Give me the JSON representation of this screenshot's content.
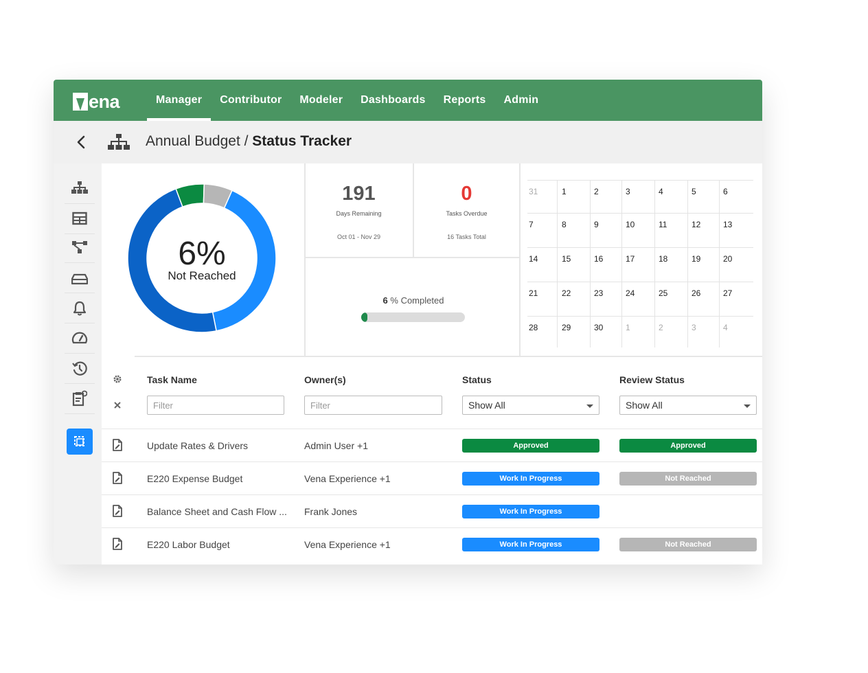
{
  "brand": {
    "logo_text": "ena",
    "nav_active_color": "#ffffff",
    "nav_bg": "#4a9562"
  },
  "nav": {
    "items": [
      {
        "label": "Manager",
        "active": true
      },
      {
        "label": "Contributor",
        "active": false
      },
      {
        "label": "Modeler",
        "active": false
      },
      {
        "label": "Dashboards",
        "active": false
      },
      {
        "label": "Reports",
        "active": false
      },
      {
        "label": "Admin",
        "active": false
      }
    ]
  },
  "breadcrumb": {
    "parent": "Annual Budget /",
    "current": "Status Tracker"
  },
  "sidebar": {
    "icons": [
      "hierarchy-icon",
      "table-grid-icon",
      "workflow-icon",
      "storage-icon",
      "bell-icon",
      "speedometer-icon",
      "history-icon",
      "clipboard-icon"
    ],
    "active_icon": "task-tracker-icon"
  },
  "donut": {
    "percent_label": "6%",
    "status_label": "Not Reached",
    "segments": [
      {
        "name": "Work In Progress (light)",
        "fraction": 0.39,
        "color": "#1a8cff"
      },
      {
        "name": "Work In Progress (dark)",
        "fraction": 0.46,
        "color": "#0b63c7"
      },
      {
        "name": "Approved",
        "fraction": 0.06,
        "color": "#0b8a41"
      },
      {
        "name": "Not Reached",
        "fraction": 0.06,
        "color": "#b6b6b6"
      }
    ]
  },
  "stats": {
    "days_remaining": {
      "value": "191",
      "label": "Days Remaining",
      "sub": "Oct 01 - Nov 29",
      "color": "#555555"
    },
    "tasks_overdue": {
      "value": "0",
      "label": "Tasks Overdue",
      "sub": "16 Tasks Total",
      "color": "#e53935"
    }
  },
  "progress": {
    "value": "6",
    "suffix": " % Completed",
    "fraction": 0.06
  },
  "calendar": {
    "weeks": [
      [
        {
          "d": "31",
          "dim": true
        },
        {
          "d": "1"
        },
        {
          "d": "2"
        },
        {
          "d": "3"
        },
        {
          "d": "4"
        },
        {
          "d": "5"
        },
        {
          "d": "6"
        }
      ],
      [
        {
          "d": "7"
        },
        {
          "d": "8"
        },
        {
          "d": "9"
        },
        {
          "d": "10"
        },
        {
          "d": "11"
        },
        {
          "d": "12"
        },
        {
          "d": "13"
        }
      ],
      [
        {
          "d": "14"
        },
        {
          "d": "15"
        },
        {
          "d": "16"
        },
        {
          "d": "17"
        },
        {
          "d": "18"
        },
        {
          "d": "19"
        },
        {
          "d": "20"
        }
      ],
      [
        {
          "d": "21"
        },
        {
          "d": "22"
        },
        {
          "d": "23"
        },
        {
          "d": "24"
        },
        {
          "d": "25"
        },
        {
          "d": "26"
        },
        {
          "d": "27"
        }
      ],
      [
        {
          "d": "28"
        },
        {
          "d": "29"
        },
        {
          "d": "30"
        },
        {
          "d": "1",
          "dim": true
        },
        {
          "d": "2",
          "dim": true
        },
        {
          "d": "3",
          "dim": true
        },
        {
          "d": "4",
          "dim": true
        }
      ]
    ]
  },
  "table": {
    "headers": {
      "task": "Task Name",
      "owner": "Owner(s)",
      "status": "Status",
      "review": "Review Status"
    },
    "filters": {
      "task_placeholder": "Filter",
      "owner_placeholder": "Filter",
      "status_value": "Show All",
      "review_value": "Show All"
    },
    "rows": [
      {
        "task": "Update Rates & Drivers",
        "owner": "Admin User +1",
        "status": {
          "text": "Approved",
          "color": "#0b8a41"
        },
        "review": {
          "text": "Approved",
          "color": "#0b8a41"
        }
      },
      {
        "task": "E220 Expense Budget",
        "owner": "Vena Experience +1",
        "status": {
          "text": "Work In Progress",
          "color": "#1a8cff"
        },
        "review": {
          "text": "Not Reached",
          "color": "#b6b6b6"
        }
      },
      {
        "task": "Balance Sheet and Cash Flow ...",
        "owner": "Frank Jones",
        "status": {
          "text": "Work In Progress",
          "color": "#1a8cff"
        },
        "review": null
      },
      {
        "task": "E220 Labor Budget",
        "owner": "Vena Experience +1",
        "status": {
          "text": "Work In Progress",
          "color": "#1a8cff"
        },
        "review": {
          "text": "Not Reached",
          "color": "#b6b6b6"
        }
      }
    ]
  }
}
